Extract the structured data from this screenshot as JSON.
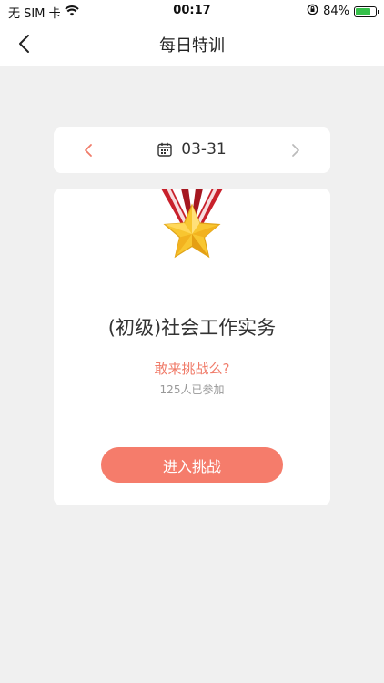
{
  "status_bar": {
    "carrier": "无 SIM 卡",
    "time": "00:17",
    "battery_percent": "84%"
  },
  "header": {
    "title": "每日特训"
  },
  "date_selector": {
    "date": "03-31"
  },
  "challenge_card": {
    "course_title": "(初级)社会工作实务",
    "challenge_prompt": "敢来挑战么?",
    "participants": "125人已参加",
    "enter_button_label": "进入挑战"
  },
  "colors": {
    "accent": "#f57c6b",
    "prompt_text": "#f07c6a",
    "background": "#f0f0f0"
  }
}
